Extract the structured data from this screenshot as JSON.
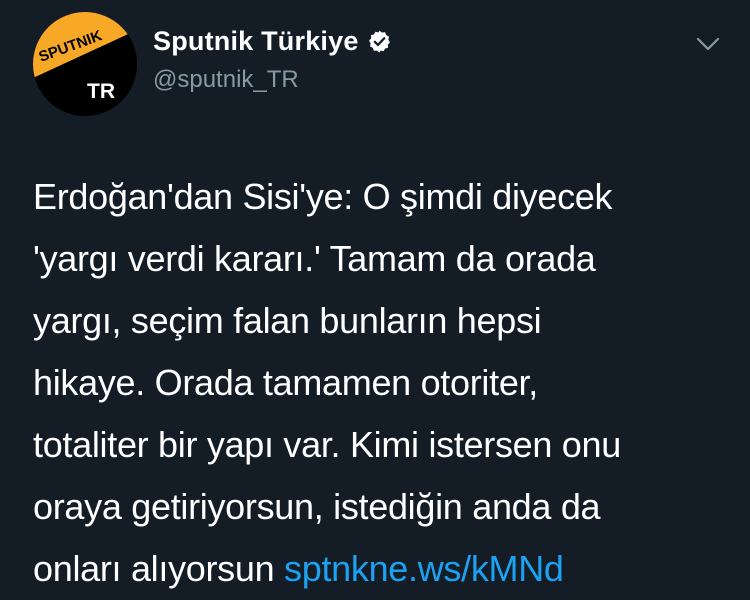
{
  "profile": {
    "display_name": "Sputnik Türkiye",
    "handle": "@sputnik_TR",
    "avatar_text_top": "SPUTNIK",
    "avatar_text_bottom": "TR",
    "verified": true,
    "brand_color": "#f7a827"
  },
  "tweet": {
    "lines": [
      "Erdoğan'dan Sisi'ye: O şimdi diyecek",
      "'yargı verdi kararı.' Tamam da orada",
      "yargı, seçim falan bunların hepsi",
      "hikaye. Orada tamamen otoriter,",
      "totaliter bir yapı var. Kimi istersen onu",
      "oraya getiriyorsun, istediğin anda da",
      "onları alıyorsun "
    ],
    "link_text": "sptnkne.ws/kMNd"
  },
  "icons": {
    "verified": "verified-badge-icon",
    "menu": "chevron-down-icon"
  },
  "colors": {
    "background": "#141d26",
    "link": "#1da1f2",
    "secondary_text": "#8899a6"
  }
}
